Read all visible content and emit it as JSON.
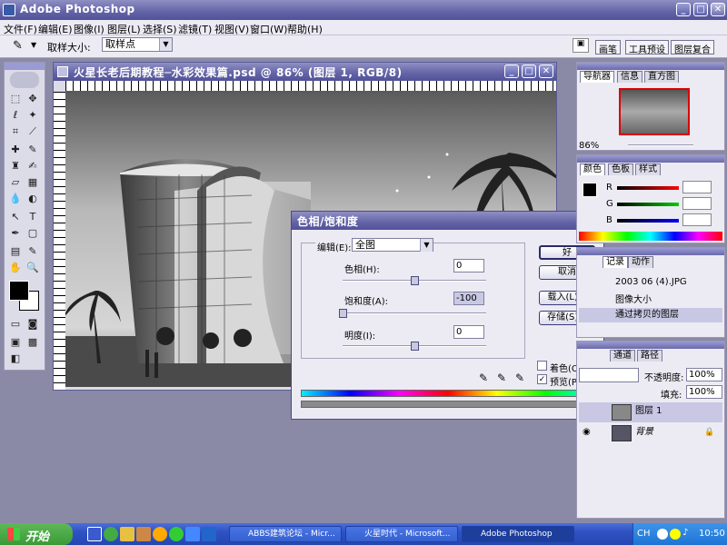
{
  "app": {
    "title": "Adobe Photoshop",
    "min": "_",
    "restore": "□",
    "close": "✕"
  },
  "menu": [
    "文件(F)",
    "编辑(E)",
    "图像(I)",
    "图层(L)",
    "选择(S)",
    "滤镜(T)",
    "视图(V)",
    "窗口(W)",
    "帮助(H)"
  ],
  "options": {
    "sample_label": "取样大小:",
    "sample_value": "取样点",
    "panel_tabs": [
      "画笔",
      "工具预设",
      "图层复合"
    ]
  },
  "document": {
    "title": "火星长老后期教程─水彩效果篇.psd @ 86% (图层 1, RGB/8)",
    "min": "_",
    "restore": "□",
    "close": "✕"
  },
  "dialog": {
    "title": "色相/饱和度",
    "close": "✕",
    "edit_label": "编辑(E):",
    "edit_value": "全图",
    "hue_label": "色相(H):",
    "hue_value": "0",
    "sat_label": "饱和度(A):",
    "sat_value": "-100",
    "light_label": "明度(I):",
    "light_value": "0",
    "ok": "好",
    "cancel": "取消",
    "load": "载入(L)...",
    "save": "存储(S)...",
    "colorize": "着色(O)",
    "preview": "预览(P)",
    "preview_check": "✓",
    "sliders": {
      "hue": 0.5,
      "sat": 0.0,
      "light": 0.5
    }
  },
  "navigator": {
    "tabs": [
      "导航器",
      "信息",
      "直方图"
    ],
    "zoom": "86%"
  },
  "color": {
    "tabs": [
      "颜色",
      "色板",
      "样式"
    ],
    "r": "R",
    "g": "G",
    "b": "B"
  },
  "history": {
    "tabs": [
      "记录",
      "动作"
    ],
    "items": [
      "2003 06 (4).JPG",
      "图像大小",
      "通过拷贝的图层"
    ]
  },
  "layers": {
    "tabs": [
      "通道",
      "路径"
    ],
    "opacity_label": "不透明度:",
    "opacity": "100%",
    "fill_label": "填充:",
    "fill": "100%",
    "items": [
      "图层 1",
      "背景"
    ]
  },
  "taskbar": {
    "start": "开始",
    "tasks": [
      "ABBS建筑论坛 - Micr...",
      "火星时代 - Microsoft...",
      "Adobe Photoshop"
    ],
    "lang": "CH",
    "time": "10:50"
  },
  "colors": {
    "accent": "#6262a6",
    "title_text": "#ffffff",
    "dialog_bg": "#ecebf3"
  }
}
